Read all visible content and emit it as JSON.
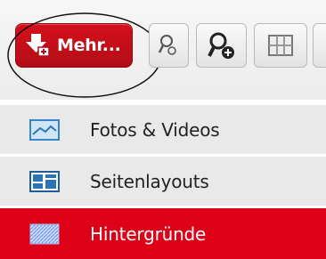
{
  "toolbar": {
    "more_button_label": "Mehr..."
  },
  "menu": {
    "items": [
      {
        "label": "Fotos & Videos",
        "icon": "photo-landscape-icon"
      },
      {
        "label": "Seitenlayouts",
        "icon": "layout-icon"
      },
      {
        "label": "Hintergründe",
        "icon": "pattern-icon"
      }
    ]
  },
  "colors": {
    "accent": "#dd0016",
    "menu_bg": "#e9e9e9",
    "toolbar_bg": "#f0f0f0"
  }
}
